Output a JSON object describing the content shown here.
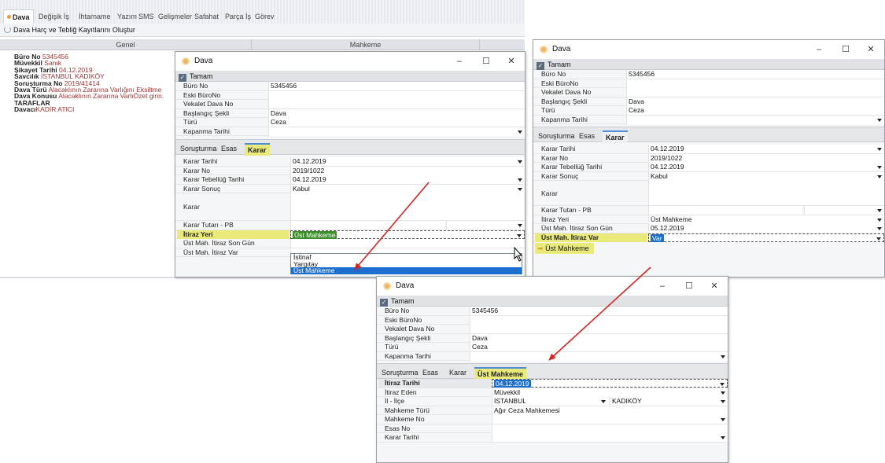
{
  "bg": {
    "tabs": [
      "Dava",
      "Değişik İş",
      "İhtarname",
      "Yazım",
      "SMS",
      "Gelişmeler",
      "Safahat",
      "Parça İş",
      "Görev"
    ],
    "action": "Dava Harç ve Tebliğ Kayıtlarını Oluştur",
    "col1": "Genel",
    "col2": "Mahkeme",
    "info": [
      {
        "k": "Büro No",
        "v": "5345456"
      },
      {
        "k": "Müvekkil",
        "v": "Sanık"
      },
      {
        "k": "Şikayet Tarihi",
        "v": "04.12.2019"
      },
      {
        "k": "Savcılık",
        "v": "İSTANBUL KADIKÖY"
      },
      {
        "k": "Soruşturma No",
        "v": "2019/41414"
      },
      {
        "k": "Dava Türü",
        "v": "Alacaklının Zararına Varlığını Eksiltme"
      },
      {
        "k": "Dava Konusu",
        "v": "Alacaklının Zararına VarlıÖzet girin."
      },
      {
        "k": "TARAFLAR",
        "v": ""
      },
      {
        "k": "Davacı",
        "v": "KADİR ATICI"
      }
    ]
  },
  "common": {
    "title": "Dava",
    "ok": "Tamam",
    "min": "–",
    "max": "☐",
    "close": "✕",
    "buro_no_label": "Büro No",
    "buro_no": "5345456",
    "eski_label": "Eski BüroNo",
    "vekalet_label": "Vekalet Dava No",
    "baslangic_label": "Başlangıç Şekli",
    "baslangic": "Dava",
    "turu_label": "Türü",
    "turu": "Ceza",
    "kapanma_label": "Kapanma Tarihi",
    "tab_sorusturma": "Soruşturma",
    "tab_esas": "Esas",
    "tab_karar": "Karar",
    "tab_ust": "Üst Mahkeme",
    "karar_tarihi_label": "Karar Tarihi",
    "karar_tarihi": "04.12.2019",
    "karar_no_label": "Karar No",
    "karar_no": "2019/1022",
    "tebellug_label": "Karar Tebellüğ Tarihi",
    "tebellug": "04.12.2019",
    "sonuc_label": "Karar Sonuç",
    "sonuc": "Kabul",
    "karar_label": "Karar",
    "tutar_label": "Karar Tutarı - PB",
    "itiraz_yeri_label": "İtiraz Yeri",
    "itiraz_yeri": "Üst Mahkeme",
    "son_gun_label": "Üst Mah. İtiraz Son Gün",
    "son_gun": "05.12.2019",
    "itiraz_var_label": "Üst Mah. İtiraz Var",
    "itiraz_var": "Var",
    "footer_link": "Üst Mahkeme"
  },
  "dropdown": [
    "İstinaf",
    "Yargıtay",
    "Üst Mahkeme"
  ],
  "w3": {
    "itiraz_tarihi_label": "İtiraz Tarihi",
    "itiraz_tarihi": "04.12.2019",
    "itiraz_eden_label": "İtiraz Eden",
    "itiraz_eden": "Müvekkil",
    "il_label": "İl - İlçe",
    "il": "İSTANBUL",
    "ilce": "KADIKÖY",
    "mahkeme_turu_label": "Mahkeme Türü",
    "mahkeme_turu": "Ağır Ceza Mahkemesi",
    "mahkeme_no_label": "Mahkeme No",
    "esas_no_label": "Esas No",
    "karar_tarihi_label": "Karar Tarihi"
  },
  "colors": {
    "arrow": "#e0201c",
    "highlight": "#e9ea7a",
    "select": "#1d6fcf"
  }
}
